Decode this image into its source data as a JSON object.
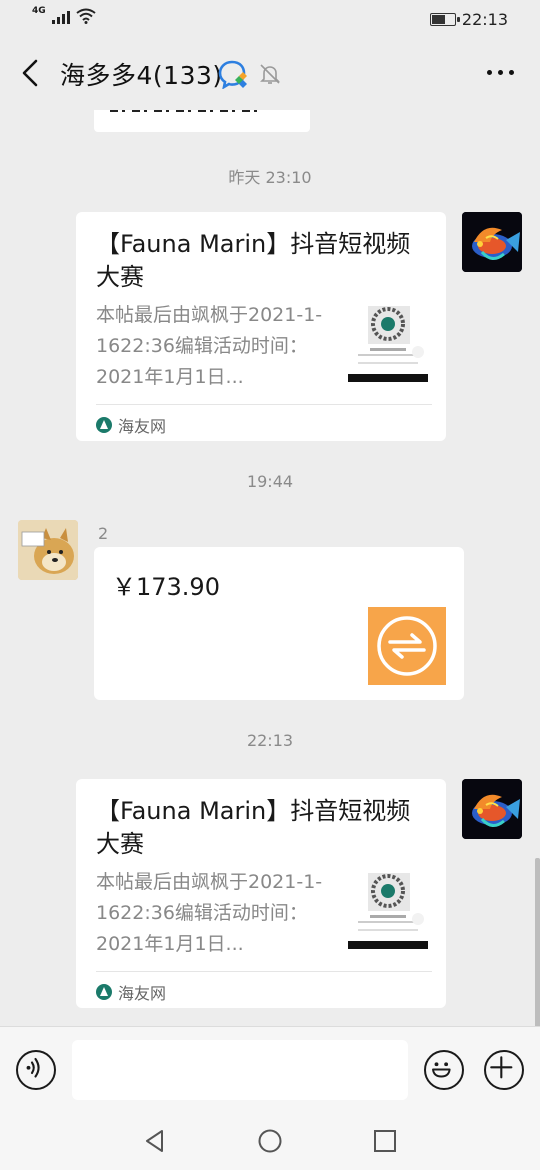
{
  "status_bar": {
    "network": "4G",
    "time": "22:13",
    "battery_level": 0.6
  },
  "header": {
    "title": "海多多4(133)"
  },
  "messages": {
    "ts1": "昨天 23:10",
    "card1": {
      "title": "【Fauna Marin】抖音短视频大赛",
      "desc": "本帖最后由飒枫于2021-1-1622:36编辑活动时间：2021年1月1日...",
      "source": "海友网"
    },
    "ts2": "19:44",
    "transfer": {
      "sender": "2",
      "amount": "￥173.90"
    },
    "ts3": "22:13",
    "card2": {
      "title": "【Fauna Marin】抖音短视频大赛",
      "desc": "本帖最后由飒枫于2021-1-1622:36编辑活动时间：2021年1月1日...",
      "source": "海友网"
    }
  },
  "input": {
    "placeholder": "",
    "value": ""
  },
  "colors": {
    "background": "#ededed",
    "transfer_orange": "#f7a54a",
    "text_gray": "#888888"
  }
}
